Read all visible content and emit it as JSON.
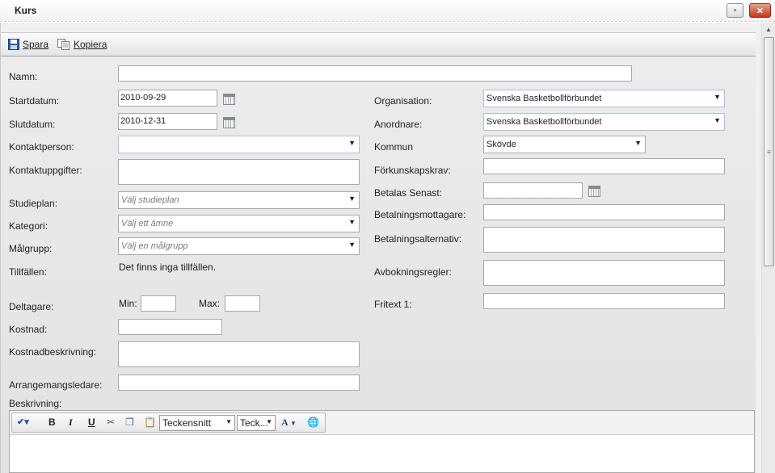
{
  "window": {
    "title": "Kurs"
  },
  "toolbar": {
    "save_label": "Spara",
    "copy_label": "Kopiera"
  },
  "form": {
    "namn": {
      "label": "Namn:",
      "value": ""
    },
    "startdatum": {
      "label": "Startdatum:",
      "value": "2010-09-29"
    },
    "slutdatum": {
      "label": "Slutdatum:",
      "value": "2010-12-31"
    },
    "kontaktperson": {
      "label": "Kontaktperson:",
      "value": ""
    },
    "kontaktuppgifter": {
      "label": "Kontaktuppgifter:",
      "value": ""
    },
    "studieplan": {
      "label": "Studieplan:",
      "placeholder": "Välj studieplan"
    },
    "kategori": {
      "label": "Kategori:",
      "placeholder": "Välj ett ämne"
    },
    "malgrupp": {
      "label": "Målgrupp:",
      "placeholder": "Välj en målgrupp"
    },
    "tillfallen": {
      "label": "Tillfällen:",
      "value": "Det finns inga tillfällen."
    },
    "deltagare": {
      "label": "Deltagare:",
      "min_label": "Min:",
      "max_label": "Max:",
      "min": "",
      "max": ""
    },
    "kostnad": {
      "label": "Kostnad:",
      "value": ""
    },
    "kostnadbeskrivning": {
      "label": "Kostnadbeskrivning:",
      "value": ""
    },
    "arrangemangsledare": {
      "label": "Arrangemangsledare:",
      "value": ""
    },
    "beskrivning": {
      "label": "Beskrivning:"
    },
    "organisation": {
      "label": "Organisation:",
      "value": "Svenska Basketbollförbundet"
    },
    "anordnare": {
      "label": "Anordnare:",
      "value": "Svenska Basketbollförbundet"
    },
    "kommun": {
      "label": "Kommun",
      "value": "Skövde"
    },
    "forkunskapskrav": {
      "label": "Förkunskapskrav:",
      "value": ""
    },
    "betalas_senast": {
      "label": "Betalas Senast:",
      "value": ""
    },
    "betalningsmottagare": {
      "label": "Betalningsmottagare:",
      "value": ""
    },
    "betalningsalternativ": {
      "label": "Betalningsalternativ:",
      "value": ""
    },
    "avbokningsregler": {
      "label": "Avbokningsregler:",
      "value": ""
    },
    "fritext1": {
      "label": "Fritext 1:",
      "value": ""
    }
  },
  "editor": {
    "font_family": "Teckensnitt",
    "font_size": "Teck...",
    "bold": "B",
    "italic": "I",
    "underline": "U",
    "font_color": "A"
  },
  "icons": [
    "save-icon",
    "copy-icon",
    "calendar-icon",
    "spellcheck-icon",
    "cut-icon",
    "paste-icon",
    "link-icon"
  ]
}
